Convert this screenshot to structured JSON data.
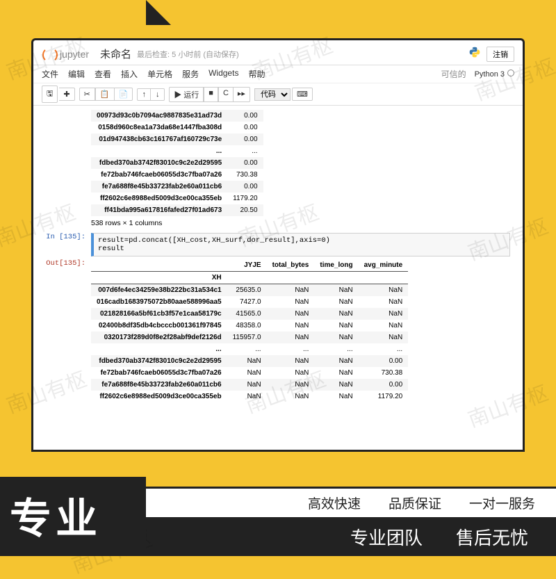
{
  "logo_text": "jupyter",
  "title": "未命名",
  "checkpoint": "最后检查: 5 小时前  (自动保存)",
  "logout": "注销",
  "menu": {
    "file": "文件",
    "edit": "编辑",
    "view": "查看",
    "insert": "插入",
    "cell": "单元格",
    "kernel": "服务",
    "widgets": "Widgets",
    "help": "帮助",
    "trusted": "可信的",
    "kernel_name": "Python 3"
  },
  "toolbar": {
    "save": "🖫",
    "add": "✚",
    "cut": "✂",
    "copy": "📋",
    "paste": "📄",
    "up": "↑",
    "down": "↓",
    "run": "▶ 运行",
    "stop": "■",
    "restart": "C",
    "fwd": "▸▸",
    "celltype": "代码",
    "keyboard": "⌨"
  },
  "out134": {
    "rows": [
      {
        "id": "00973d93c0b7094ac9887835e31ad73d",
        "v": "0.00"
      },
      {
        "id": "0158d960c8ea1a73da68e1447fba308d",
        "v": "0.00"
      },
      {
        "id": "01d947438cb63c161767af160729c73e",
        "v": "0.00"
      },
      {
        "id": "...",
        "v": "..."
      },
      {
        "id": "fdbed370ab3742f83010c9c2e2d29595",
        "v": "0.00"
      },
      {
        "id": "fe72bab746fcaeb06055d3c7fba07a26",
        "v": "730.38"
      },
      {
        "id": "fe7a688f8e45b33723fab2e60a011cb6",
        "v": "0.00"
      },
      {
        "id": "ff2602c6e8988ed5009d3ce00ca355eb",
        "v": "1179.20"
      },
      {
        "id": "ff41bda995a617816fafed27f01ad673",
        "v": "20.50"
      }
    ],
    "dims": "538 rows × 1 columns"
  },
  "cell135": {
    "prompt": "In [135]:",
    "code": "result=pd.concat([XH_cost,XH_surf,dor_result],axis=0)\nresult"
  },
  "out135": {
    "prompt": "Out[135]:",
    "headers": [
      "JYJE",
      "total_bytes",
      "time_long",
      "avg_minute"
    ],
    "index_name": "XH",
    "rows": [
      {
        "id": "007d6fe4ec34259e38b222bc31a534c1",
        "c": [
          "25635.0",
          "NaN",
          "NaN",
          "NaN"
        ]
      },
      {
        "id": "016cadb1683975072b80aae588996aa5",
        "c": [
          "7427.0",
          "NaN",
          "NaN",
          "NaN"
        ]
      },
      {
        "id": "021828166a5bf61cb3f57e1caa58179c",
        "c": [
          "41565.0",
          "NaN",
          "NaN",
          "NaN"
        ]
      },
      {
        "id": "02400b8df35db4cbcccb001361f97845",
        "c": [
          "48358.0",
          "NaN",
          "NaN",
          "NaN"
        ]
      },
      {
        "id": "0320173f289d0f8e2f28abf9def2126d",
        "c": [
          "115957.0",
          "NaN",
          "NaN",
          "NaN"
        ]
      },
      {
        "id": "...",
        "c": [
          "...",
          "...",
          "...",
          "..."
        ]
      },
      {
        "id": "fdbed370ab3742f83010c9c2e2d29595",
        "c": [
          "NaN",
          "NaN",
          "NaN",
          "0.00"
        ]
      },
      {
        "id": "fe72bab746fcaeb06055d3c7fba07a26",
        "c": [
          "NaN",
          "NaN",
          "NaN",
          "730.38"
        ]
      },
      {
        "id": "fe7a688f8e45b33723fab2e60a011cb6",
        "c": [
          "NaN",
          "NaN",
          "NaN",
          "0.00"
        ]
      },
      {
        "id": "ff2602c6e8988ed5009d3ce00ca355eb",
        "c": [
          "NaN",
          "NaN",
          "NaN",
          "1179.20"
        ]
      }
    ]
  },
  "promo": {
    "tag": "专业",
    "b1a": "高效快速",
    "b1b": "品质保证",
    "b1c": "一对一服务",
    "b2a": "专业团队",
    "b2b": "售后无忧"
  },
  "watermark": "南山有枢"
}
